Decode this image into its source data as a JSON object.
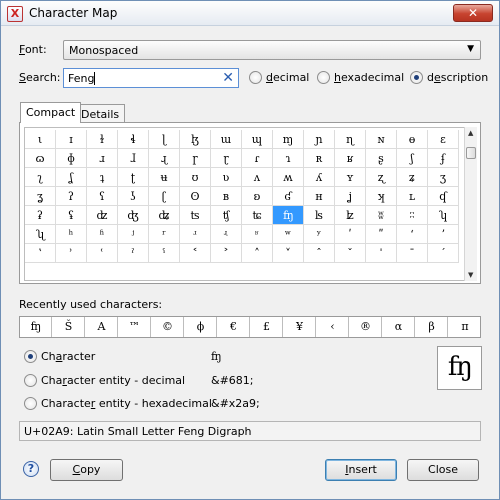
{
  "window": {
    "title": "Character Map",
    "app_icon": "app-x-icon",
    "close_glyph": "✕"
  },
  "font": {
    "label_accel": "F",
    "label_rest": "ont:",
    "value": "Monospaced",
    "arrow": "▼"
  },
  "search": {
    "label_accel": "S",
    "label_rest": "earch:",
    "value": "Feng",
    "clear_glyph": "✕",
    "modes": [
      {
        "pre": "",
        "accel": "d",
        "post": "ecimal",
        "selected": false
      },
      {
        "pre": "",
        "accel": "h",
        "post": "exadecimal",
        "selected": false
      },
      {
        "pre": "d",
        "accel": "e",
        "post": "scription",
        "selected": true
      }
    ]
  },
  "tabs": [
    {
      "label": "Compact",
      "active": true
    },
    {
      "label": "Details",
      "active": false
    }
  ],
  "grid": {
    "columns": 14,
    "selected": [
      4,
      8
    ],
    "rows": [
      [
        "ι",
        "ɪ",
        "ɫ",
        "ɬ",
        "ɭ",
        "ɮ",
        "ɯ",
        "ɰ",
        "ɱ",
        "ɲ",
        "ɳ",
        "ɴ",
        "ɵ",
        "ɛ"
      ],
      [
        "ɷ",
        "ɸ",
        "ɹ",
        "ɺ",
        "ɻ",
        "ɼ",
        "ɽ",
        "ɾ",
        "ɿ",
        "ʀ",
        "ʁ",
        "ʂ",
        "ʃ",
        "ʄ"
      ],
      [
        "ʅ",
        "ʆ",
        "ʇ",
        "ʈ",
        "ʉ",
        "ʊ",
        "ʋ",
        "ʌ",
        "ʍ",
        "ʎ",
        "ʏ",
        "ʐ",
        "ʑ",
        "ʒ"
      ],
      [
        "ʓ",
        "ʔ",
        "ʕ",
        "ʖ",
        "ʗ",
        "ʘ",
        "ʙ",
        "ʚ",
        "ʛ",
        "ʜ",
        "ʝ",
        "ʞ",
        "ʟ",
        "ʠ"
      ],
      [
        "ʡ",
        "ʢ",
        "ʣ",
        "ʤ",
        "ʥ",
        "ʦ",
        "ʧ",
        "ʨ",
        "ʩ",
        "ʪ",
        "ʫ",
        "ʬ",
        "ʭ",
        "ʮ"
      ],
      [
        "ʯ",
        "ʰ",
        "ʱ",
        "ʲ",
        "ʳ",
        "ʴ",
        "ʵ",
        "ʶ",
        "ʷ",
        "ʸ",
        "ʹ",
        "ʺ",
        "ʻ",
        "ʼ"
      ],
      [
        "ʽ",
        "ʾ",
        "ʿ",
        "ˀ",
        "ˁ",
        "˂",
        "˃",
        "˄",
        "˅",
        "ˆ",
        "ˇ",
        "ˈ",
        "ˉ",
        "ˊ"
      ]
    ]
  },
  "recent": {
    "label": "Recently used characters:",
    "chars": [
      "ʩ",
      "Š",
      "A",
      "™",
      "©",
      "ϕ",
      "€",
      "£",
      "¥",
      "‹",
      "®",
      "α",
      "β",
      "π"
    ]
  },
  "options": [
    {
      "pre": "Ch",
      "accel": "a",
      "post": "racter",
      "value": "ʩ",
      "selected": true
    },
    {
      "pre": "Cha",
      "accel": "r",
      "post": "acter entity - decimal",
      "value": "&#681;",
      "selected": false
    },
    {
      "pre": "Characte",
      "accel": "r",
      "post": " entity - hexadecimal",
      "value": "&#x2a9;",
      "selected": false
    }
  ],
  "preview_char": "ʩ",
  "status_text": "U+02A9: Latin Small Letter Feng Digraph",
  "buttons": {
    "help_glyph": "?",
    "copy": {
      "accel": "C",
      "rest": "opy"
    },
    "insert": {
      "accel": "I",
      "rest": "nsert"
    },
    "close": "Close"
  }
}
